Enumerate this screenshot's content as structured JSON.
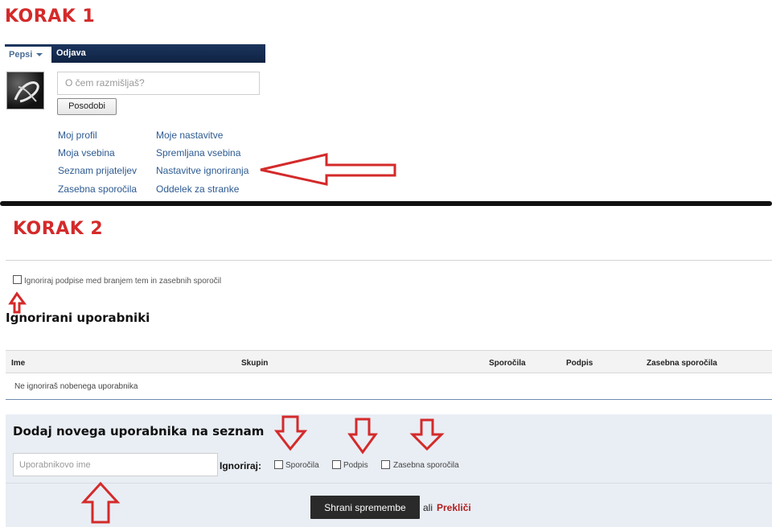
{
  "step1": {
    "title": "KORAK 1"
  },
  "step2": {
    "title": "KORAK 2"
  },
  "navbar": {
    "user_menu": "Pepsi",
    "logout": "Odjava"
  },
  "status": {
    "placeholder": "O čem razmišljaš?",
    "update_button": "Posodobi"
  },
  "links": {
    "col1": [
      "Moj profil",
      "Moja vsebina",
      "Seznam prijateljev",
      "Zasebna sporočila"
    ],
    "col2": [
      "Moje nastavitve",
      "Spremljana vsebina",
      "Nastavitve ignoriranja",
      "Oddelek za stranke"
    ]
  },
  "ignore_signatures": {
    "label": "Ignoriraj podpise med branjem tem in zasebnih sporočil",
    "checked": false
  },
  "ignored_users": {
    "title": "Ignorirani uporabniki",
    "columns": [
      "Ime",
      "Skupin",
      "Sporočila",
      "Podpis",
      "Zasebna sporočila"
    ],
    "empty_message": "Ne ignoriraš nobenega uporabnika"
  },
  "add_user": {
    "title": "Dodaj novega uporabnika na seznam",
    "username_placeholder": "Uporabnikovo ime",
    "ignore_label": "Ignoriraj:",
    "options": [
      {
        "label": "Sporočila",
        "checked": false
      },
      {
        "label": "Podpis",
        "checked": false
      },
      {
        "label": "Zasebna sporočila",
        "checked": false
      }
    ],
    "save_button": "Shrani spremembe",
    "or_text": "ali",
    "cancel_link": "Prekliči"
  },
  "colors": {
    "annotation_red": "#d42a2a",
    "navbar": "#1c355d",
    "link": "#2d5a91",
    "panel_bg": "#e9eef4"
  }
}
